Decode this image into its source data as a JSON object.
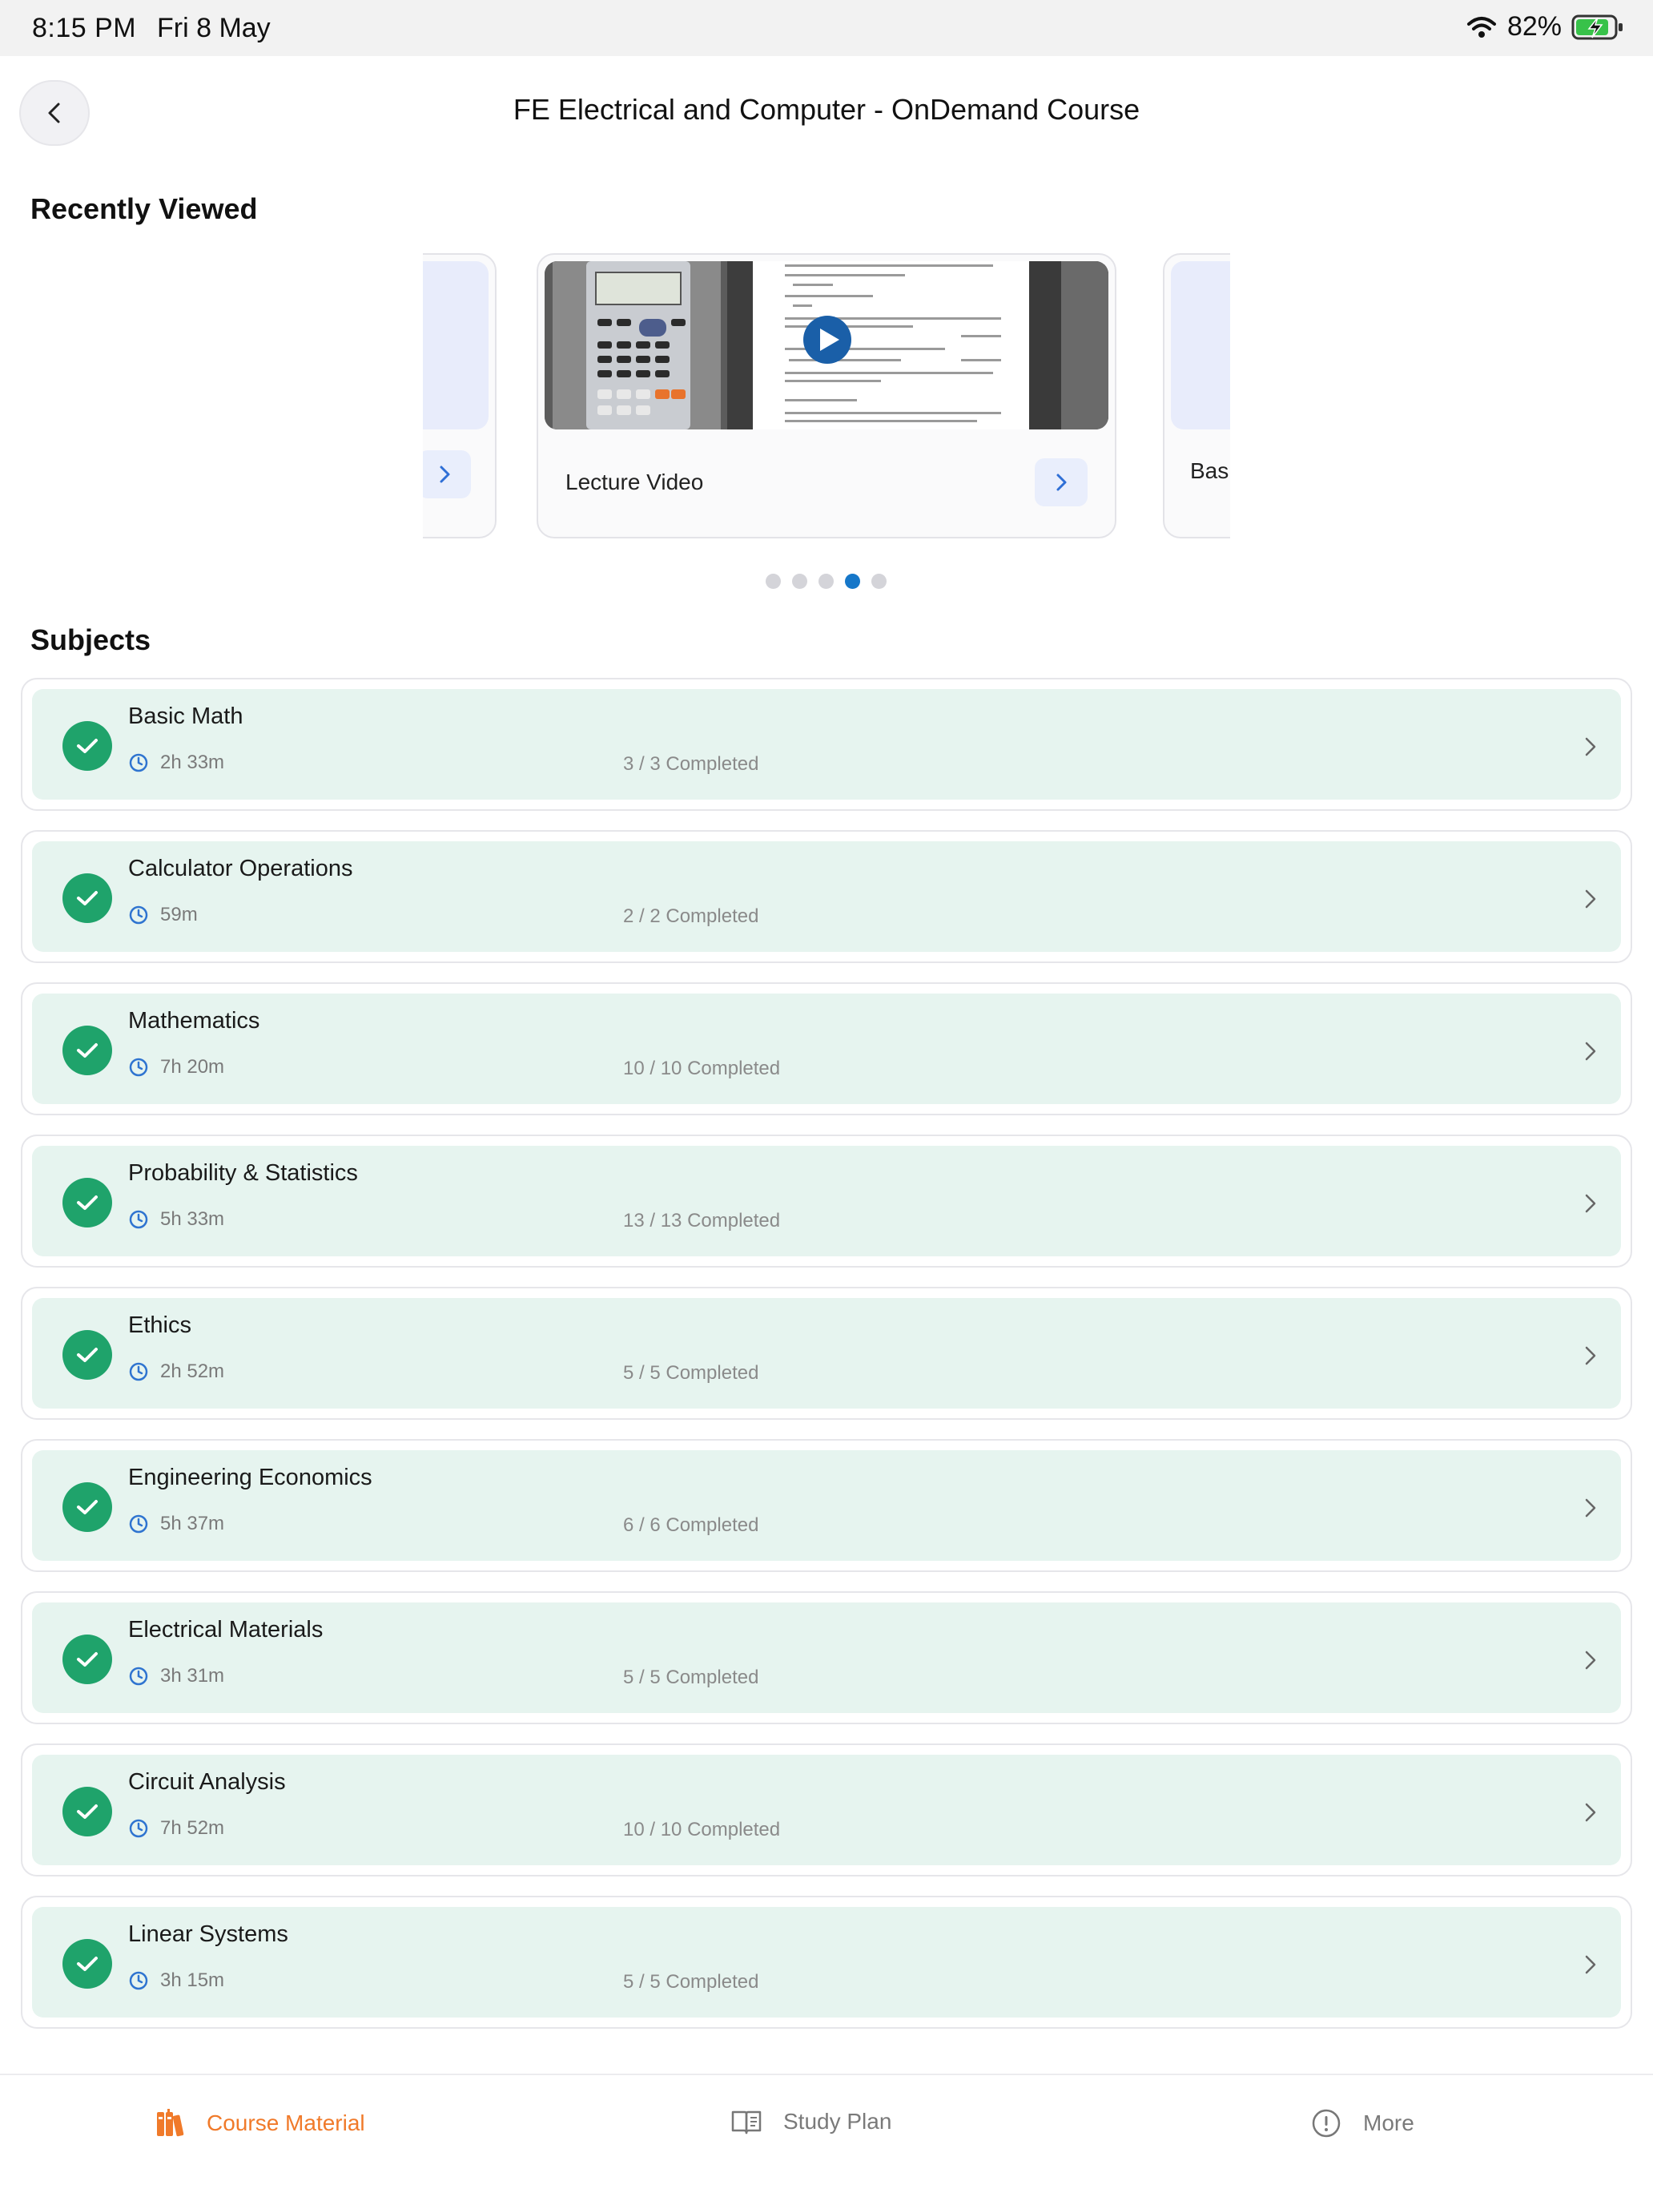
{
  "status_bar": {
    "time": "8:15 PM",
    "date": "Fri 8 May",
    "battery": "82%"
  },
  "header": {
    "title": "FE Electrical and Computer - OnDemand Course"
  },
  "recently_viewed": {
    "title": "Recently Viewed",
    "cards": [
      {
        "label": ""
      },
      {
        "label": "Lecture Video"
      },
      {
        "label": "Basi"
      }
    ],
    "pager": {
      "count": 5,
      "active_index": 3
    }
  },
  "subjects": {
    "title": "Subjects",
    "items": [
      {
        "name": "Basic Math",
        "duration": "2h 33m",
        "progress": "3 / 3 Completed"
      },
      {
        "name": "Calculator Operations",
        "duration": "59m",
        "progress": "2 / 2 Completed"
      },
      {
        "name": "Mathematics",
        "duration": "7h 20m",
        "progress": "10 / 10 Completed"
      },
      {
        "name": "Probability & Statistics",
        "duration": "5h 33m",
        "progress": "13 / 13 Completed"
      },
      {
        "name": "Ethics",
        "duration": "2h 52m",
        "progress": "5 / 5 Completed"
      },
      {
        "name": "Engineering Economics",
        "duration": "5h 37m",
        "progress": "6 / 6 Completed"
      },
      {
        "name": "Electrical Materials",
        "duration": "3h 31m",
        "progress": "5 / 5 Completed"
      },
      {
        "name": "Circuit Analysis",
        "duration": "7h 52m",
        "progress": "10 / 10 Completed"
      },
      {
        "name": "Linear Systems",
        "duration": "3h 15m",
        "progress": "5 / 5 Completed"
      }
    ]
  },
  "tab_bar": {
    "tabs": [
      {
        "label": "Course Material",
        "icon": "books-icon",
        "active": true
      },
      {
        "label": "Study Plan",
        "icon": "open-book-icon",
        "active": false
      },
      {
        "label": "More",
        "icon": "info-icon",
        "active": false
      }
    ]
  },
  "colors": {
    "accent": "#f07a2a",
    "complete": "#1fa36b",
    "row_bg": "#e6f4ef",
    "pager_active": "#1677c9"
  }
}
